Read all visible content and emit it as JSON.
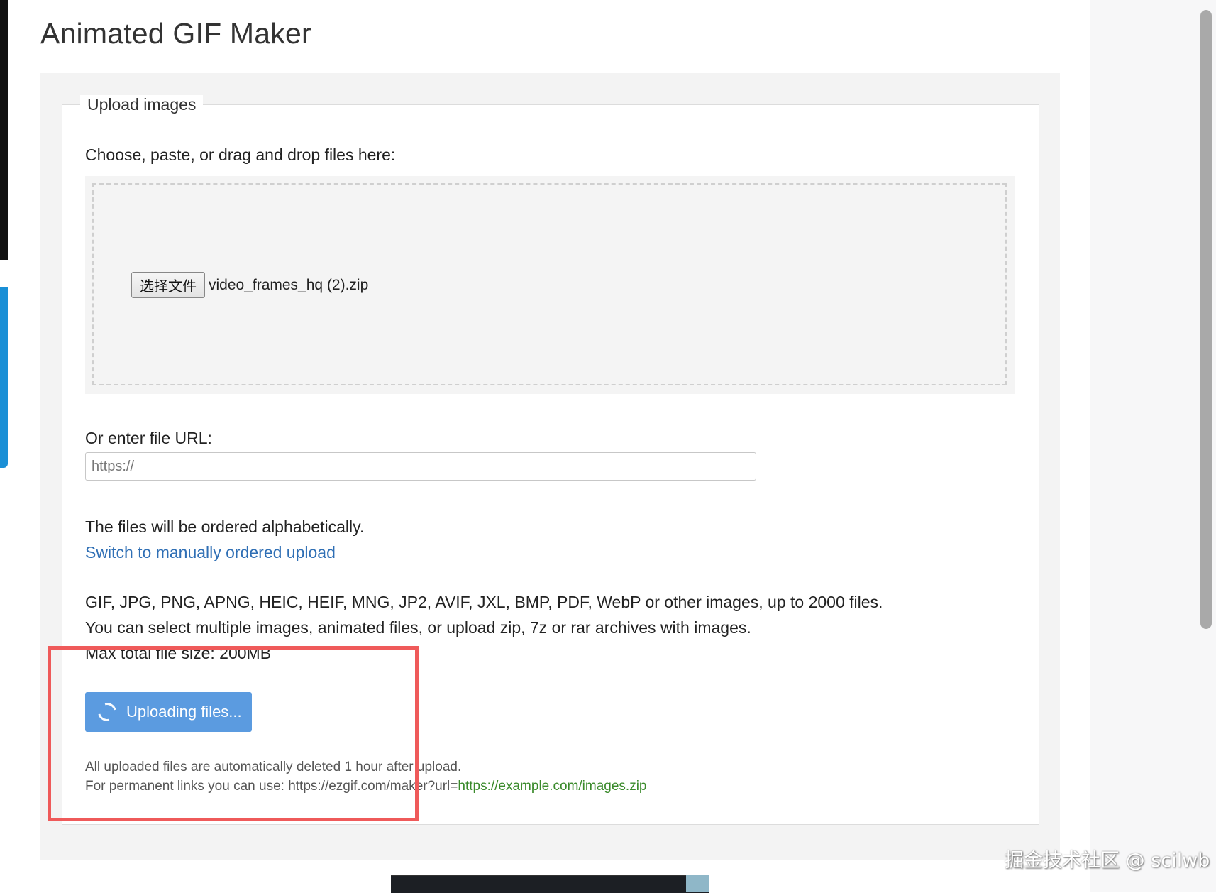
{
  "page": {
    "title": "Animated GIF Maker"
  },
  "upload": {
    "legend": "Upload images",
    "choose_label": "Choose, paste, or drag and drop files here:",
    "file_button_label": "选择文件",
    "selected_file": "video_frames_hq (2).zip",
    "url_label": "Or enter file URL:",
    "url_placeholder": "https://",
    "url_value": "",
    "order_text": "The files will be ordered alphabetically.",
    "manual_order_link": "Switch to manually ordered upload",
    "formats_line": "GIF, JPG, PNG, APNG, HEIC, HEIF, MNG, JP2, AVIF, JXL, BMP, PDF, WebP or other images, up to 2000 files.",
    "multiple_line": "You can select multiple images, animated files, or upload zip, 7z or rar archives with images.",
    "max_size_line": "Max total file size: 200MB",
    "upload_button_label": "Uploading files...",
    "deletion_note": "All uploaded files are automatically deleted 1 hour after upload.",
    "permalink_prefix": "For permanent links you can use: https://ezgif.com/maker?url=",
    "permalink_example": "https://example.com/images.zip"
  },
  "watermark": "掘金技术社区 @ scilwb",
  "colors": {
    "link": "#2f6fb5",
    "button": "#5b9be0",
    "highlight": "#ef5a5a",
    "green_link": "#3a8a2b"
  }
}
